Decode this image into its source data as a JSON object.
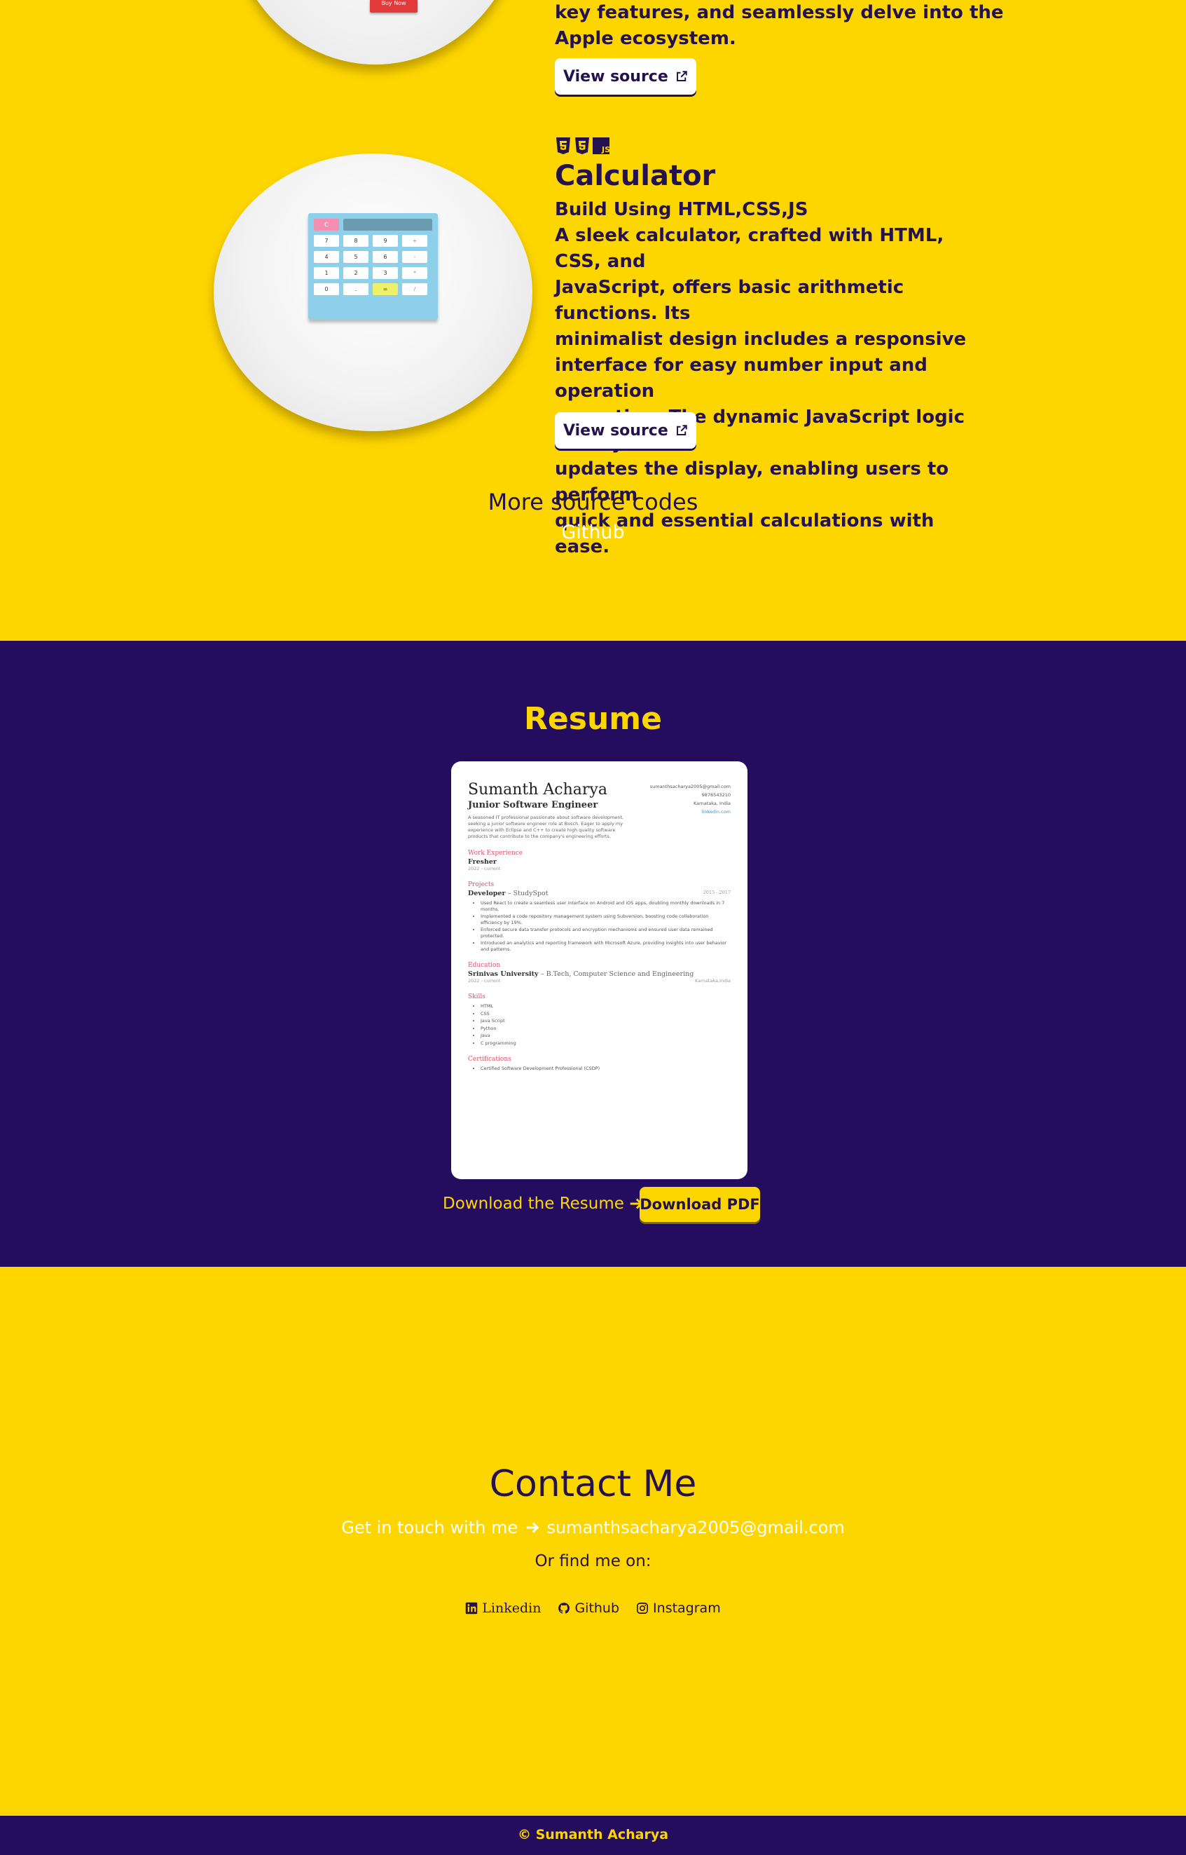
{
  "projects": {
    "apple": {
      "buy_label": "Buy Now",
      "desc_line1": "key features, and seamlessly delve into the",
      "desc_line2": "Apple ecosystem.",
      "view_source": "View source"
    },
    "calculator": {
      "tech_icons": [
        "html5-icon",
        "css3-icon",
        "javascript-icon"
      ],
      "js_label": "JS",
      "title": "Calculator",
      "subtitle": "Build Using HTML,CSS,JS",
      "desc_lines": [
        "A sleek calculator, crafted with HTML, CSS, and",
        "JavaScript, offers basic arithmetic functions. Its",
        "minimalist design includes a responsive",
        "interface for easy number input and operation",
        "execution. The dynamic JavaScript logic swiftly",
        "updates the display, enabling users to perform",
        "quick and essential calculations with ease."
      ],
      "view_source": "View source",
      "keys": [
        [
          "7",
          "8",
          "9",
          "+"
        ],
        [
          "4",
          "5",
          "6",
          "-"
        ],
        [
          "1",
          "2",
          "3",
          "*"
        ],
        [
          "0",
          ".",
          "=",
          "/"
        ]
      ],
      "clear_key": "C"
    },
    "more_title": "More source codes",
    "more_link": "Github"
  },
  "resume": {
    "title": "Resume",
    "card": {
      "name": "Sumanth Acharya",
      "role": "Junior Software Engineer",
      "summary": "A seasoned IT professional passionate about software development, seeking a junior software engineer role at Bosch. Eager to apply my experience with Eclipse and C++ to create high quality software products that contribute to the company's engineering efforts.",
      "contact": [
        "sumanthsacharya2005@gmail.com",
        "9876543210",
        "Karnataka, India",
        "linkedin.com"
      ],
      "work_heading": "Work Experience",
      "work_role": "Fresher",
      "work_date": "2022 - current",
      "projects_heading": "Projects",
      "project_role": "Developer",
      "project_name": "StudySpot",
      "project_date": "2015 - 2017",
      "project_bullets": [
        "Used React to create a seamless user interface on Android and iOS apps, doubling monthly downloads in 7 months.",
        "Implemented a code repository management system using Subversion, boosting code collaboration efficiency by 19%.",
        "Enforced secure data transfer protocols and encryption mechanisms and ensured user data remained protected.",
        "Introduced an analytics and reporting framework with Microsoft Azure, providing insights into user behavior and patterns."
      ],
      "education_heading": "Education",
      "school": "Srinivas University",
      "degree": "B.Tech, Computer Science and Engineering",
      "edu_date": "2022 - current",
      "edu_place": "Karnataka,India",
      "skills_heading": "Skills",
      "skills": [
        "HTML",
        "CSS",
        "Java Script",
        "Python",
        "Java",
        "C programming"
      ],
      "cert_heading": "Certifications",
      "certs": [
        "Certified Software Development Professional (CSDP)"
      ]
    },
    "download_text": "Download the Resume",
    "download_btn": "Download PDF"
  },
  "contact": {
    "title": "Contact Me",
    "line_prefix": "Get in touch with me",
    "email": "sumanthsacharya2005@gmail.com",
    "alt": "Or find me on:",
    "socials": [
      {
        "icon": "linkedin-icon",
        "label": "Linkedin"
      },
      {
        "icon": "github-icon",
        "label": "Github"
      },
      {
        "icon": "instagram-icon",
        "label": "Instagram"
      }
    ]
  },
  "footer": {
    "text": "© Sumanth Acharya"
  }
}
